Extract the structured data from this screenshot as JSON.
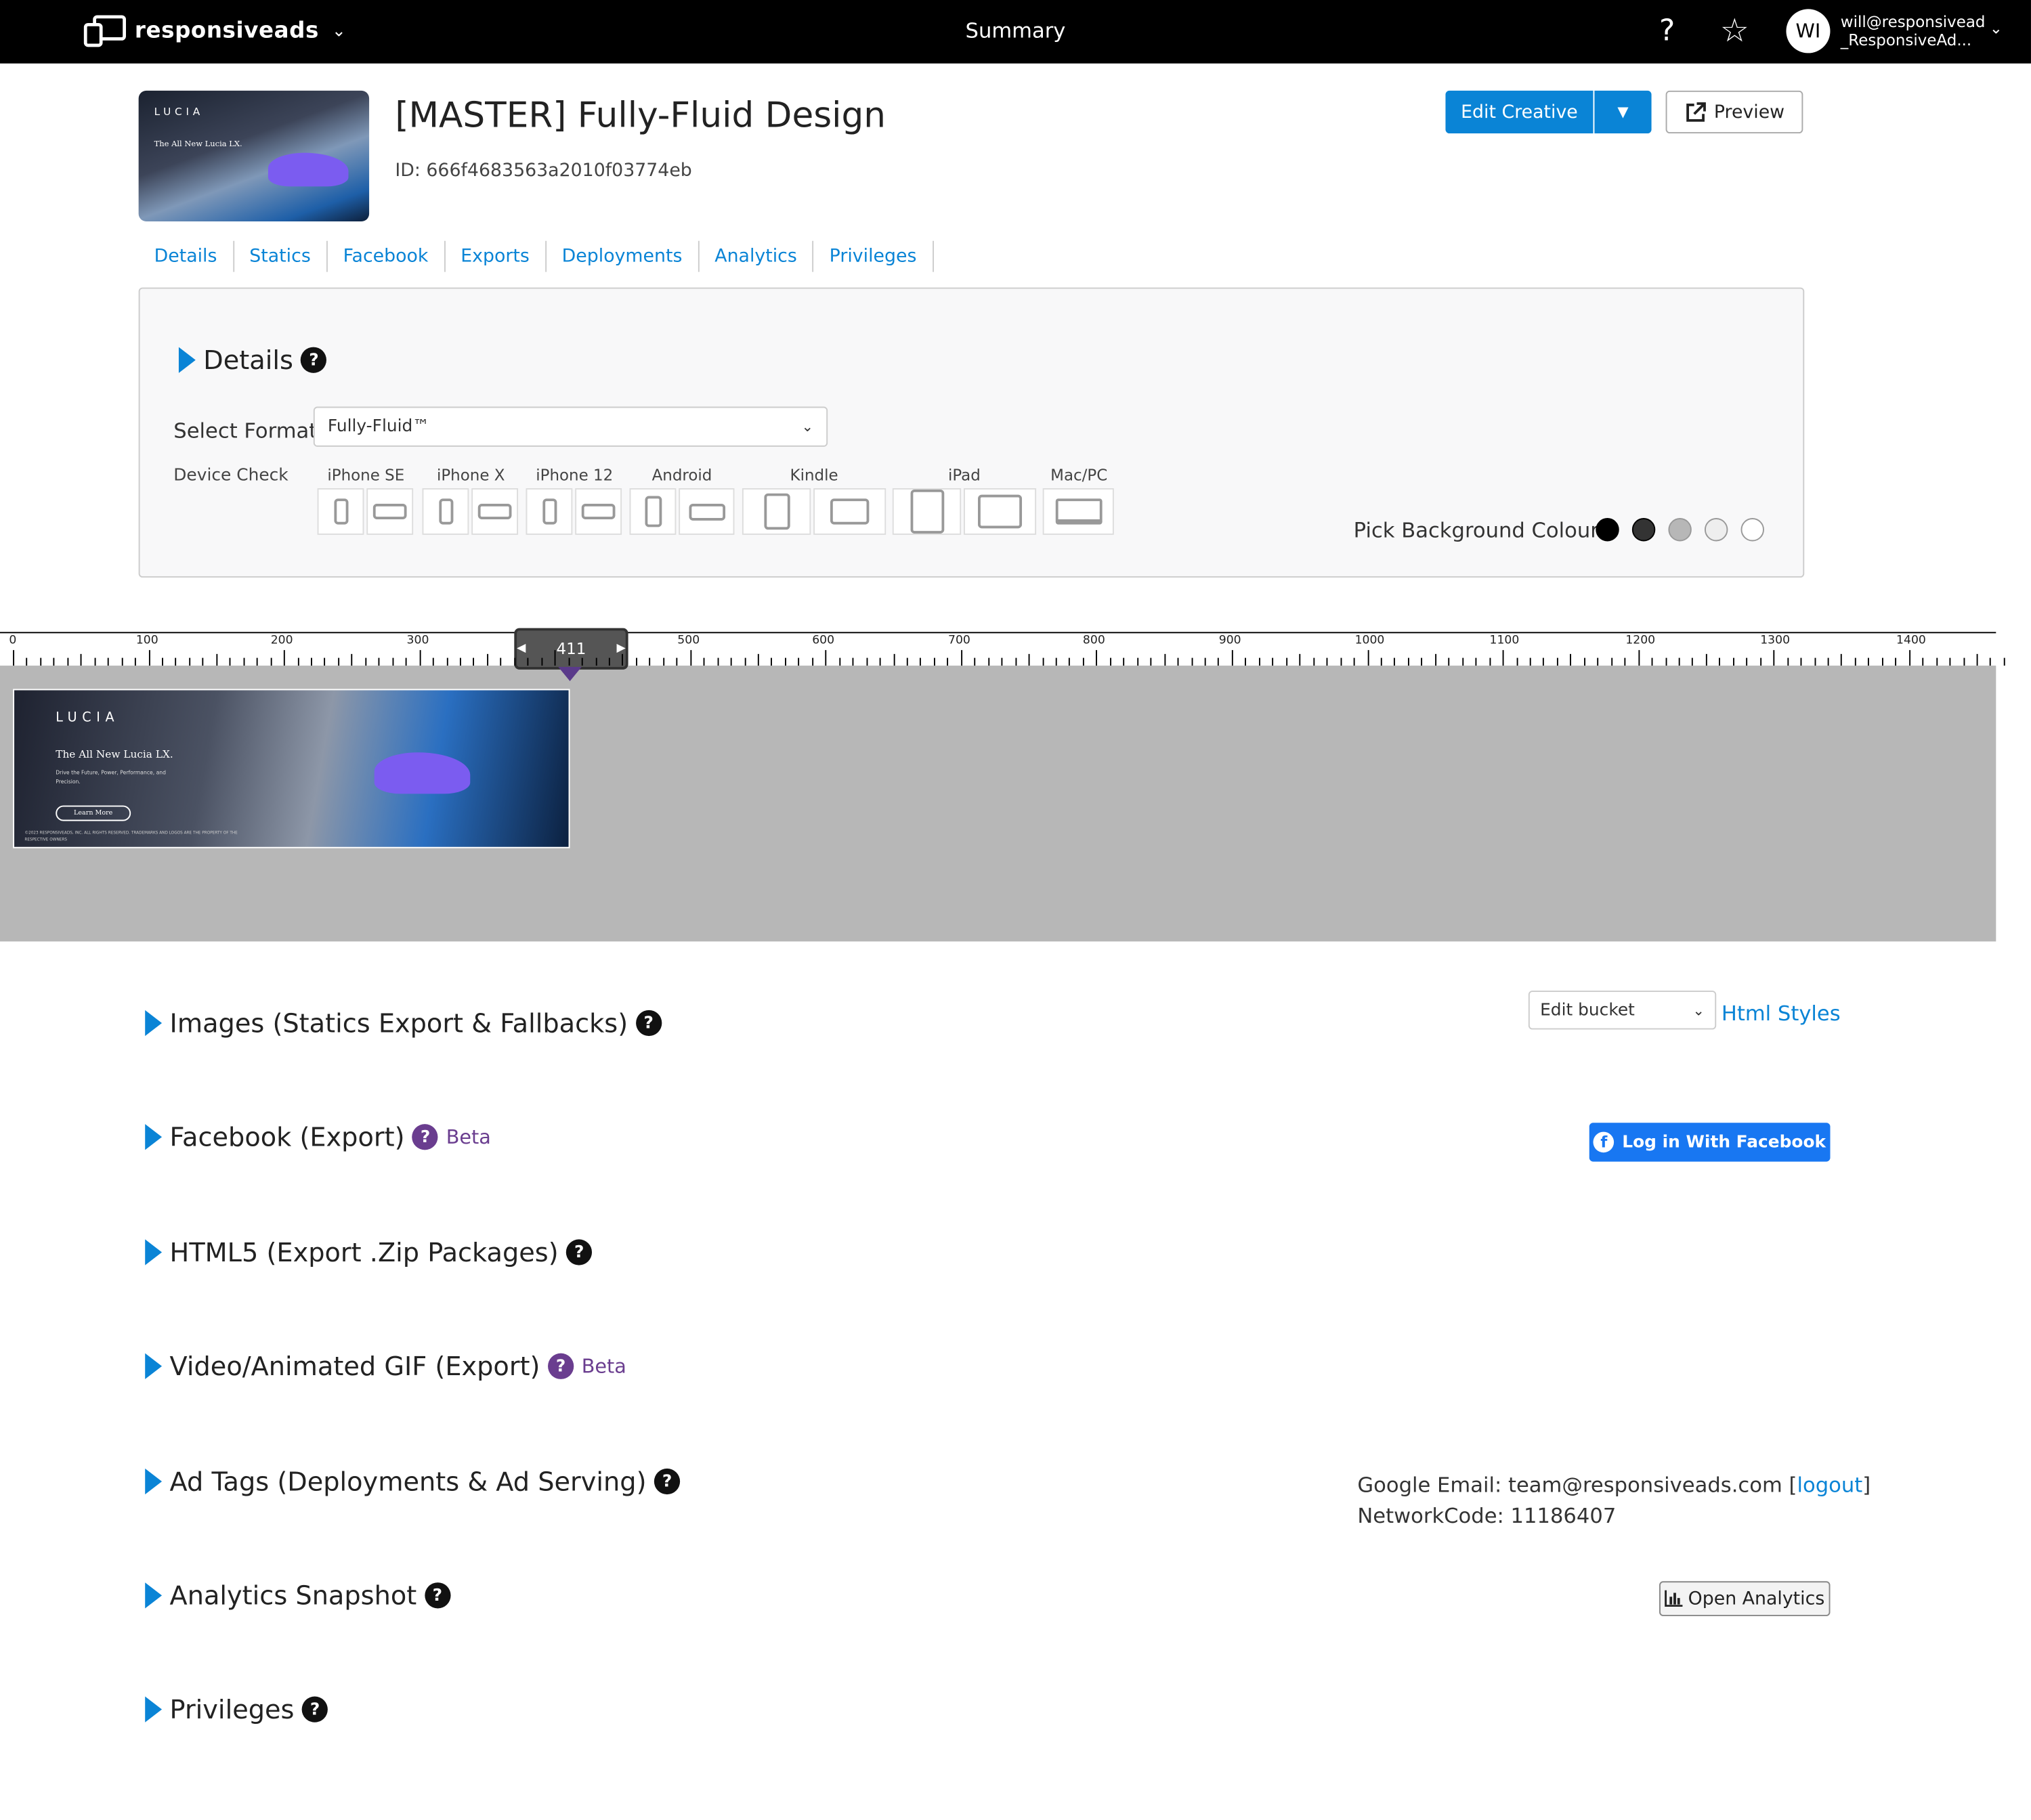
{
  "topbar": {
    "logo_text": "responsiveads",
    "title": "Summary",
    "avatar_initials": "WI",
    "user_line1": "will@responsivead",
    "user_line2": "_ResponsiveAd..."
  },
  "creative": {
    "title": "[MASTER] Fully-Fluid Design",
    "id_text": "ID: 666f4683563a2010f03774eb",
    "edit_label": "Edit Creative",
    "preview_label": "Preview",
    "thumb_brand": "LUCIA",
    "thumb_headline": "The All New Lucia LX."
  },
  "tabs": [
    "Details",
    "Statics",
    "Facebook",
    "Exports",
    "Deployments",
    "Analytics",
    "Privileges"
  ],
  "details": {
    "title": "Details",
    "format_label": "Select Format",
    "format_value": "Fully-Fluid™",
    "device_check_label": "Device Check",
    "devices": [
      "iPhone SE",
      "iPhone X",
      "iPhone 12",
      "Android",
      "Kindle",
      "iPad",
      "Mac/PC"
    ],
    "bg_label": "Pick Background Colour:",
    "bg_colors": [
      "#000000",
      "#333333",
      "#b7b7b7",
      "#eeeeee",
      "#ffffff"
    ]
  },
  "ruler": {
    "labels": [
      "0",
      "100",
      "200",
      "300",
      "400",
      "500",
      "600",
      "700",
      "800",
      "900",
      "1000",
      "1100",
      "1200",
      "1300",
      "1400"
    ],
    "handle_value": "411"
  },
  "ad": {
    "brand": "LUCIA",
    "headline": "The All New Lucia LX.",
    "sub": "Drive the Future, Power, Performance, and Precision.",
    "cta": "Learn More",
    "legal": "©2023 RESPONSIVEADS, INC. ALL RIGHTS RESERVED. TRADEMARKS AND LOGOS ARE THE PROPERTY OF THE RESPECTIVE OWNERS"
  },
  "sections": {
    "images": "Images (Statics Export & Fallbacks)",
    "edit_bucket": "Edit bucket",
    "html_styles": "Html Styles",
    "facebook": "Facebook (Export)",
    "facebook_beta": "Beta",
    "fb_login": "Log in With Facebook",
    "html5": "HTML5 (Export .Zip Packages)",
    "video": "Video/Animated GIF (Export)",
    "video_beta": "Beta",
    "adtags": "Ad Tags (Deployments & Ad Serving)",
    "google_email_prefix": "Google Email: team@responsiveads.com [",
    "logout": "logout",
    "google_email_suffix": "]",
    "network_code": "NetworkCode: 11186407",
    "analytics": "Analytics Snapshot",
    "open_analytics": "Open Analytics",
    "privileges": "Privileges"
  },
  "colors": {
    "accent": "#0a84d6",
    "beta_purple": "#6a3d8f",
    "facebook_blue": "#1877f2"
  }
}
